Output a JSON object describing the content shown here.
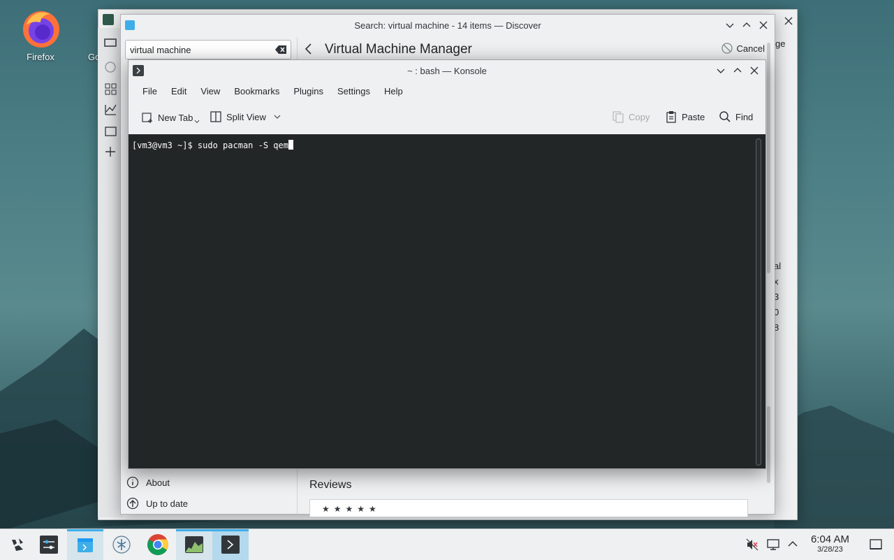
{
  "desktop": {
    "icons": [
      {
        "label": "Firefox"
      },
      {
        "label": "Go"
      }
    ]
  },
  "back_window": {
    "right_text_fragments": [
      "ge",
      "al",
      "x",
      "3",
      "0",
      "8"
    ]
  },
  "discover": {
    "title": "Search: virtual machine - 14 items — Discover",
    "search_value": "virtual machine",
    "header_title": "Virtual Machine Manager",
    "cancel_label": "Cancel",
    "sidebar": {
      "about": "About",
      "up_to_date": "Up to date"
    },
    "reviews_title": "Reviews",
    "stars": "★★★★★"
  },
  "konsole": {
    "title": "~ : bash — Konsole",
    "menu": [
      "File",
      "Edit",
      "View",
      "Bookmarks",
      "Plugins",
      "Settings",
      "Help"
    ],
    "toolbar": {
      "new_tab": "New Tab",
      "split_view": "Split View",
      "copy": "Copy",
      "paste": "Paste",
      "find": "Find"
    },
    "terminal": {
      "prompt": "[vm3@vm3 ~]$ ",
      "command": "sudo pacman -S qem"
    }
  },
  "taskbar": {
    "time": "6:04 AM",
    "date": "3/28/23"
  }
}
